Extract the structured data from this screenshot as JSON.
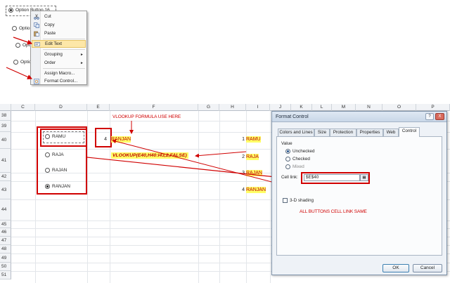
{
  "top_snippet": {
    "selected_option": "Option Button 16",
    "option_labels": [
      "Optio",
      "Opt",
      "Optio"
    ],
    "context_menu": {
      "items": [
        {
          "label": "Cut",
          "icon": "scissors-icon"
        },
        {
          "label": "Copy",
          "icon": "copy-icon"
        },
        {
          "label": "Paste",
          "icon": "paste-icon"
        },
        {
          "label": "Edit Text",
          "icon": "edit-text-icon",
          "highlighted": true
        },
        {
          "label": "Grouping",
          "submenu": true
        },
        {
          "label": "Order",
          "submenu": true
        },
        {
          "label": "Assign Macro...",
          "icon": ""
        },
        {
          "label": "Format Control...",
          "icon": "format-control-icon"
        }
      ]
    }
  },
  "sheet": {
    "columns": [
      "C",
      "D",
      "E",
      "F",
      "G",
      "H",
      "I",
      "J",
      "K",
      "L",
      "M",
      "N",
      "O",
      "P"
    ],
    "rows": [
      "38",
      "39",
      "40",
      "41",
      "42",
      "43",
      "44",
      "45",
      "46",
      "47",
      "48",
      "49",
      "50",
      "51"
    ],
    "option_buttons": [
      "RAMU",
      "RAJA",
      "RAJAN",
      "RANJAN"
    ],
    "selected_option_index": 3,
    "linked_cell_value": "4",
    "result_value": "RANJAN",
    "lookup_table": [
      {
        "number": "1",
        "name": "RAMU"
      },
      {
        "number": "2",
        "name": "RAJA"
      },
      {
        "number": "3",
        "name": "RAJAN"
      },
      {
        "number": "4",
        "name": "RANJAN"
      }
    ],
    "annotations": {
      "vlookup_note": "VLOOKUP FORMULA USE HERE",
      "formula": "VLOOKUP(E40,H40:I43,2,FALSE)",
      "cell_link_note": "ALL BUTTONS CELL LINK SAME"
    },
    "colors": {
      "highlight": "#ffff66",
      "annotation_red": "#d00000"
    }
  },
  "dialog": {
    "title": "Format Control",
    "help_button": "?",
    "close_button": "X",
    "tabs": [
      "Colors and Lines",
      "Size",
      "Protection",
      "Properties",
      "Web",
      "Control"
    ],
    "active_tab": "Control",
    "value_group_label": "Value",
    "value_options": [
      {
        "label": "Unchecked",
        "checked": true,
        "enabled": true
      },
      {
        "label": "Checked",
        "checked": false,
        "enabled": true
      },
      {
        "label": "Mixed",
        "checked": false,
        "enabled": false
      }
    ],
    "cell_link_label": "Cell link:",
    "cell_link_value": "$E$40",
    "shading_label": "3-D shading",
    "ok_label": "OK",
    "cancel_label": "Cancel"
  }
}
